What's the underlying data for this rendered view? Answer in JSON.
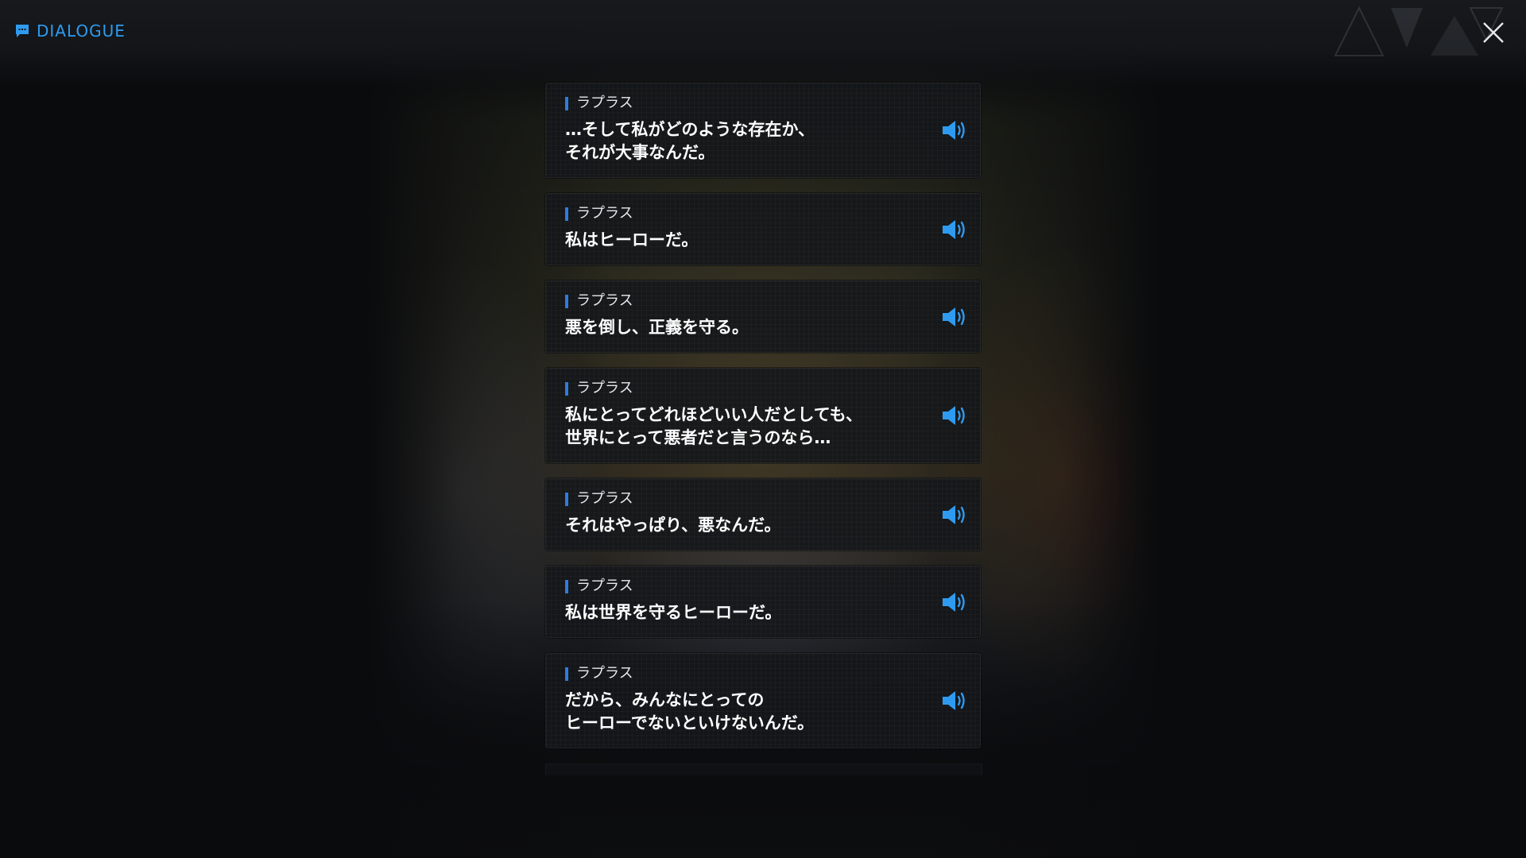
{
  "header": {
    "title": "DIALOGUE",
    "icon": "chat-bubble-icon",
    "close_icon": "close-icon"
  },
  "colors": {
    "accent": "#2f9bf0",
    "speaker_bar": "#2f7ce0",
    "card_bg": "#14161a"
  },
  "dialogue": [
    {
      "speaker": "ラプラス",
      "text": "…そして私がどのような存在か、\nそれが大事なんだ。",
      "voice_icon": "speaker-icon"
    },
    {
      "speaker": "ラプラス",
      "text": "私はヒーローだ。",
      "voice_icon": "speaker-icon"
    },
    {
      "speaker": "ラプラス",
      "text": "悪を倒し、正義を守る。",
      "voice_icon": "speaker-icon"
    },
    {
      "speaker": "ラプラス",
      "text": "私にとってどれほどいい人だとしても、\n世界にとって悪者だと言うのなら…",
      "voice_icon": "speaker-icon"
    },
    {
      "speaker": "ラプラス",
      "text": "それはやっぱり、悪なんだ。",
      "voice_icon": "speaker-icon"
    },
    {
      "speaker": "ラプラス",
      "text": "私は世界を守るヒーローだ。",
      "voice_icon": "speaker-icon"
    },
    {
      "speaker": "ラプラス",
      "text": "だから、みんなにとっての\nヒーローでないといけないんだ。",
      "voice_icon": "speaker-icon"
    }
  ]
}
